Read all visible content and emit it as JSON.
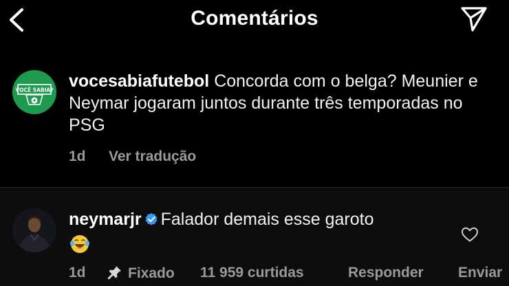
{
  "header": {
    "title": "Comentários"
  },
  "post": {
    "username": "vocesabiafutebol",
    "text": "Concorda com o belga? Meunier e Neymar jogaram juntos durante três temporadas no PSG",
    "avatar_text": "VOCÊ SABIA?",
    "time": "1d",
    "translate_label": "Ver tradução"
  },
  "reply": {
    "username": "neymarjr",
    "text": "Falador demais esse garoto",
    "emoji": "😂",
    "time": "1d",
    "pinned_label": "Fixado",
    "likes_label": "11 959 curtidas",
    "reply_label": "Responder",
    "send_label": "Enviar"
  },
  "colors": {
    "background": "#000000",
    "reply_background": "#0d0d0d",
    "meta_text": "#9a9a9a",
    "verified": "#3897f0",
    "brand_green": "#1d9a4e"
  },
  "icons": {
    "back": "chevron-left-icon",
    "send": "paper-plane-icon",
    "verified": "verified-badge-icon",
    "heart": "heart-outline-icon",
    "pin": "pin-icon"
  }
}
